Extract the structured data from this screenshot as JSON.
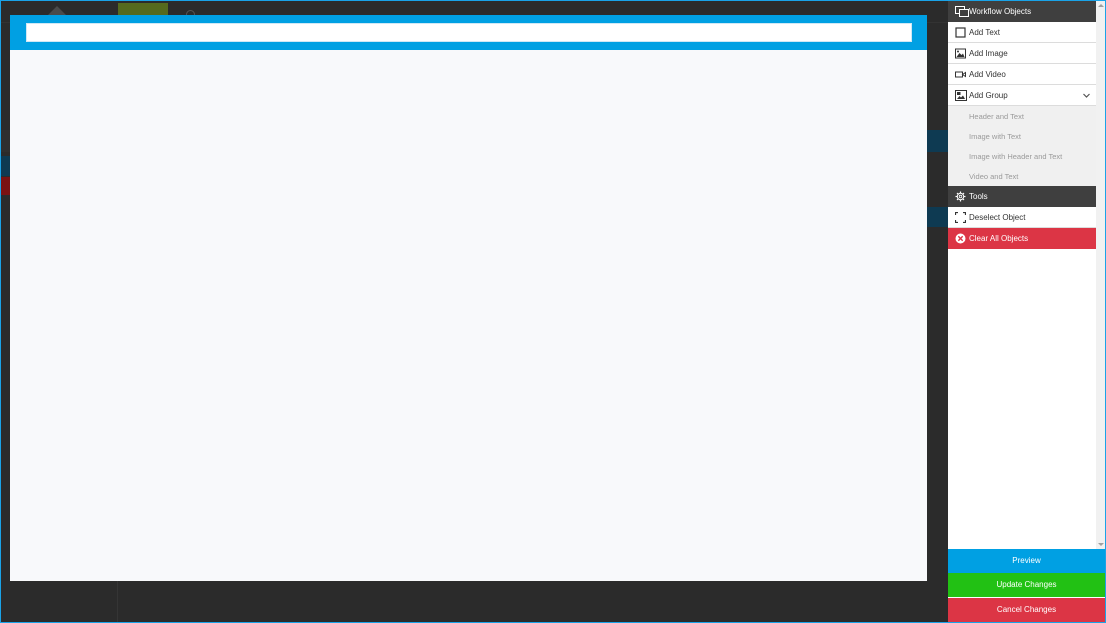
{
  "canvas": {
    "title_value": "",
    "header_color": "#00a0e3"
  },
  "sidebar": {
    "workflow_section": {
      "label": "Workflow Objects",
      "icon": "workflow-objects-icon"
    },
    "items": [
      {
        "label": "Add Text",
        "icon": "text-box-icon"
      },
      {
        "label": "Add Image",
        "icon": "image-icon"
      },
      {
        "label": "Add Video",
        "icon": "video-camera-icon"
      },
      {
        "label": "Add Group",
        "icon": "group-icon",
        "expanded": true
      }
    ],
    "group_options": [
      "Header and Text",
      "Image with Text",
      "Image with Header and Text",
      "Video and Text"
    ],
    "tools_section": {
      "label": "Tools",
      "icon": "gear-icon"
    },
    "tools": [
      {
        "label": "Deselect Object",
        "icon": "deselect-icon"
      },
      {
        "label": "Clear All Objects",
        "icon": "clear-circle-icon",
        "color": "#dc3545"
      }
    ]
  },
  "footer": {
    "preview_label": "Preview",
    "update_label": "Update Changes",
    "cancel_label": "Cancel Changes",
    "preview_color": "#00a0e3",
    "update_color": "#22c114",
    "cancel_color": "#dc3545"
  }
}
